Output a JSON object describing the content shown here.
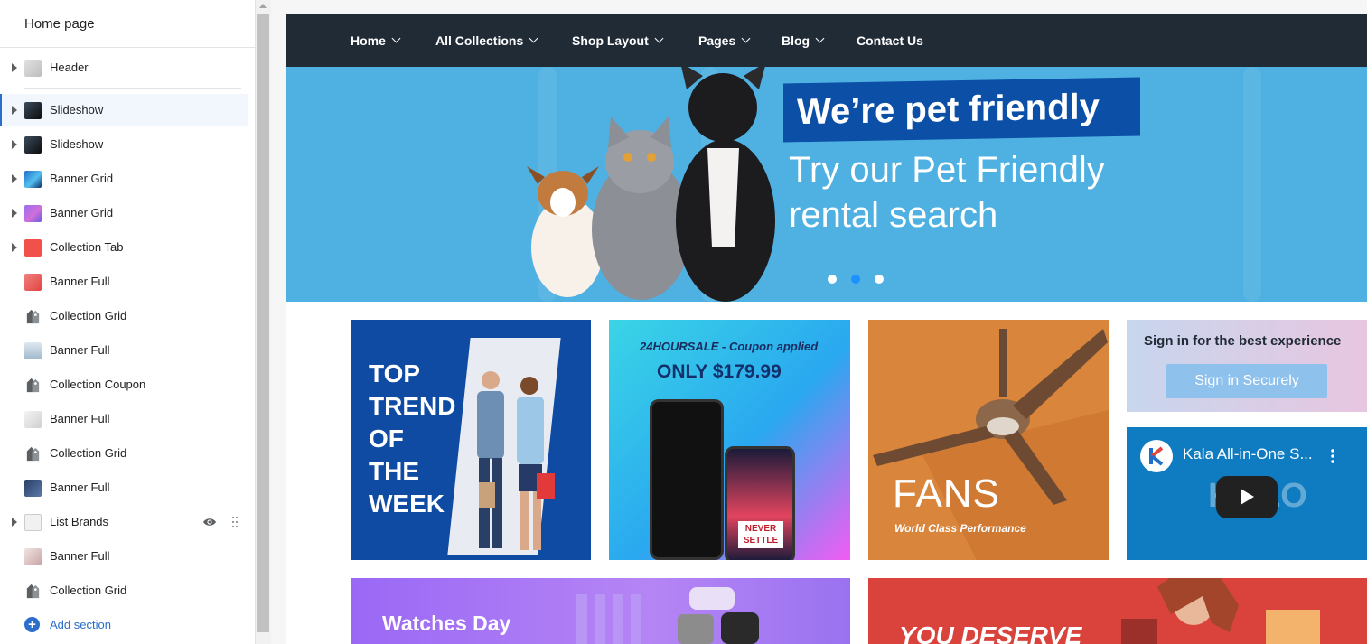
{
  "sidebar": {
    "title": "Home page",
    "items": [
      {
        "label": "Header"
      },
      {
        "label": "Slideshow"
      },
      {
        "label": "Slideshow"
      },
      {
        "label": "Banner Grid"
      },
      {
        "label": "Banner Grid"
      },
      {
        "label": "Collection Tab"
      },
      {
        "label": "Banner Full"
      },
      {
        "label": "Collection Grid"
      },
      {
        "label": "Banner Full"
      },
      {
        "label": "Collection Coupon"
      },
      {
        "label": "Banner Full"
      },
      {
        "label": "Collection Grid"
      },
      {
        "label": "Banner Full"
      },
      {
        "label": "List Brands"
      },
      {
        "label": "Banner Full"
      },
      {
        "label": "Collection Grid"
      }
    ],
    "add_section": "Add section"
  },
  "nav": {
    "items": [
      "Home",
      "All Collections",
      "Shop Layout",
      "Pages",
      "Blog",
      "Contact Us"
    ]
  },
  "hero": {
    "badge": "We’re pet friendly",
    "line1": "Try our Pet Friendly",
    "line2": "rental search",
    "active_dot": 2
  },
  "banners": {
    "trend": [
      "TOP",
      "TREND",
      "OF",
      "THE",
      "WEEK"
    ],
    "coupon_small": "24HOURSALE - Coupon applied",
    "coupon_price": "ONLY $179.99",
    "phone_text": "NEVER SETTLE",
    "fans_title": "FANS",
    "fans_sub": "World Class Performance",
    "signin_text": "Sign in for the best experience",
    "signin_button": "Sign in Securely",
    "video_title": "Kala All-in-One S...",
    "watches": "Watches Day",
    "deserve": "YOU DESERVE"
  },
  "colors": {
    "accent": "#2c6ecb",
    "nav_bg": "#212b36",
    "hero_bg": "#4fb0e2"
  }
}
